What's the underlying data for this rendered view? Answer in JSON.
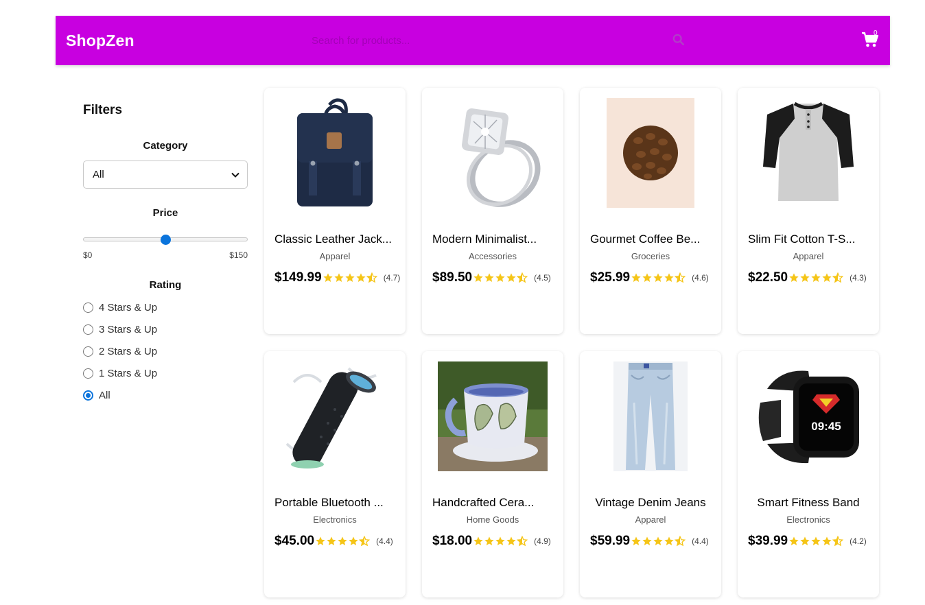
{
  "header": {
    "brand": "ShopZen",
    "search_placeholder": "Search for products...",
    "cart_count": "0",
    "colors": {
      "nav_bg": "#c800e0",
      "accent": "#0b74dc",
      "star": "#f5c518"
    }
  },
  "sidebar": {
    "title": "Filters",
    "category_title": "Category",
    "category_value": "All",
    "price_title": "Price",
    "price_min_label": "$0",
    "price_max_label": "$150",
    "price_slider_fraction": 0.5,
    "rating_title": "Rating",
    "rating_options": [
      {
        "label": "4 Stars & Up",
        "checked": false
      },
      {
        "label": "3 Stars & Up",
        "checked": false
      },
      {
        "label": "2 Stars & Up",
        "checked": false
      },
      {
        "label": "1 Stars & Up",
        "checked": false
      },
      {
        "label": "All",
        "checked": true
      }
    ]
  },
  "products": [
    {
      "name": "Classic Leather Jack...",
      "category": "Apparel",
      "price": "$149.99",
      "rating": "(4.7)",
      "image": "backpack"
    },
    {
      "name": "Modern Minimalist...",
      "category": "Accessories",
      "price": "$89.50",
      "rating": "(4.5)",
      "image": "ring"
    },
    {
      "name": "Gourmet Coffee Be...",
      "category": "Groceries",
      "price": "$25.99",
      "rating": "(4.6)",
      "image": "coffee-beans"
    },
    {
      "name": "Slim Fit Cotton T-S...",
      "category": "Apparel",
      "price": "$22.50",
      "rating": "(4.3)",
      "image": "raglan-shirt"
    },
    {
      "name": "Portable Bluetooth ...",
      "category": "Electronics",
      "price": "$45.00",
      "rating": "(4.4)",
      "image": "speaker"
    },
    {
      "name": "Handcrafted Cera...",
      "category": "Home Goods",
      "price": "$18.00",
      "rating": "(4.9)",
      "image": "mug"
    },
    {
      "name": "Vintage Denim Jeans",
      "category": "Apparel",
      "price": "$59.99",
      "rating": "(4.4)",
      "image": "jeans"
    },
    {
      "name": "Smart Fitness Band",
      "category": "Electronics",
      "price": "$39.99",
      "rating": "(4.2)",
      "image": "smartwatch",
      "watch_time": "09:45"
    }
  ]
}
